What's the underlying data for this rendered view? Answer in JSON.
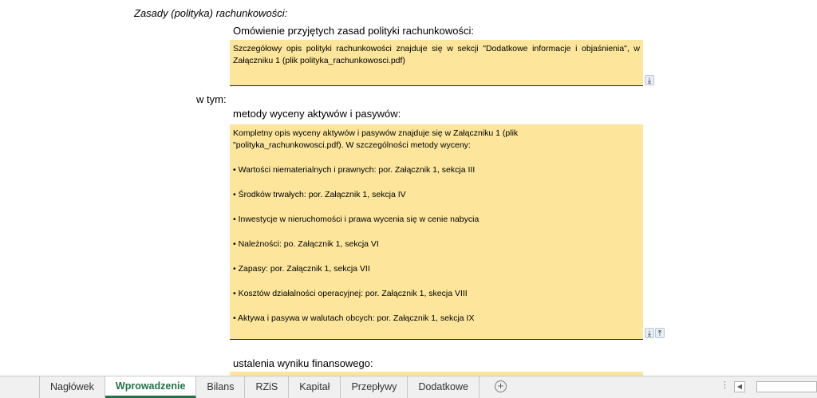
{
  "section": {
    "title": "Zasady (polityka) rachunkowości:"
  },
  "omowienie": {
    "label": "Omówienie przyjętych zasad polityki rachunkowości:",
    "text": "Szczegółowy opis polityki rachunkowości znajduje się w sekcji \"Dodatkowe informacje i objaśnienia\", w Załączniku 1 (plik polityka_rachunkowosci.pdf)"
  },
  "w_tym": "w tym:",
  "metody": {
    "label": "metody wyceny aktywów i pasywów:",
    "intro_line1": "Kompletny opis wyceny aktywów i pasywów znajduje się w Załączniku 1 (plik",
    "intro_line2": "\"polityka_rachunkowosci.pdf). W szczególności metody wyceny:",
    "items": [
      "• Wartości niematerialnych i prawnych: por. Załącznik 1, sekcja III",
      "• Środków trwałych:  por. Załącznik 1, sekcja IV",
      "• Inwestycje w nieruchomości i prawa wycenia się w cenie nabycia",
      "• Należności: po. Załącznik 1, sekcja VI",
      "• Zapasy: por. Załącznik 1, sekcja VII",
      "• Kosztów działalności operacyjnej: por. Załącznik 1, skecja VIII",
      "• Aktywa i pasywa w walutach obcych: por. Załącznik 1, sekcja IX"
    ]
  },
  "wynik": {
    "label": "ustalenia wyniku finansowego:"
  },
  "controls": {
    "expand_glyph": "⤓",
    "collapse_glyph": "⤒"
  },
  "tabbar": {
    "tabs": [
      "Nagłówek",
      "Wprowadzenie",
      "Bilans",
      "RZiS",
      "Kapitał",
      "Przepływy",
      "Dodatkowe"
    ],
    "active_tab": "Wprowadzenie",
    "add_glyph": "+",
    "more_glyph": "⋮",
    "scroll_left_glyph": "◀"
  },
  "colors": {
    "field_bg": "#fde59b",
    "active_tab": "#217346"
  }
}
